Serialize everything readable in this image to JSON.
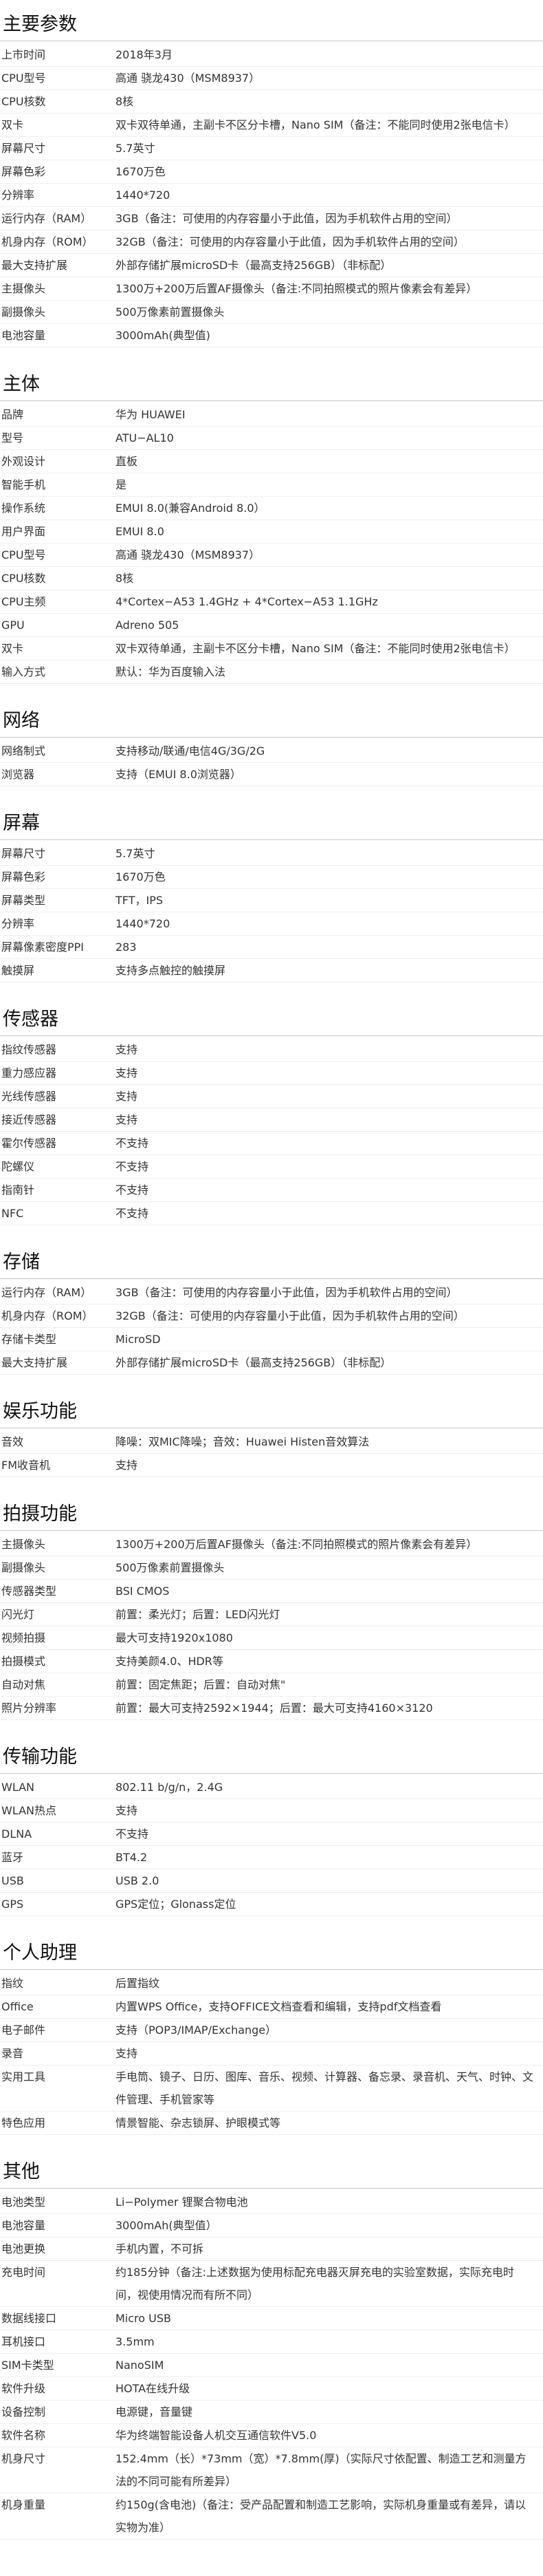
{
  "sections": [
    {
      "title": "主要参数",
      "rows": [
        {
          "label": "上市时间",
          "value": "2018年3月"
        },
        {
          "label": "CPU型号",
          "value": "高通 骁龙430（MSM8937）"
        },
        {
          "label": "CPU核数",
          "value": "8核"
        },
        {
          "label": "双卡",
          "value": "双卡双待单通，主副卡不区分卡槽，Nano SIM（备注：不能同时使用2张电信卡）"
        },
        {
          "label": "屏幕尺寸",
          "value": "5.7英寸"
        },
        {
          "label": "屏幕色彩",
          "value": "1670万色"
        },
        {
          "label": "分辨率",
          "value": "1440*720"
        },
        {
          "label": "运行内存（RAM）",
          "value": "3GB（备注：可使用的内存容量小于此值，因为手机软件占用的空间）"
        },
        {
          "label": "机身内存（ROM）",
          "value": "32GB（备注：可使用的内存容量小于此值，因为手机软件占用的空间）"
        },
        {
          "label": "最大支持扩展",
          "value": "外部存储扩展microSD卡（最高支持256GB）（非标配）"
        },
        {
          "label": "主摄像头",
          "value": "1300万+200万后置AF摄像头（备注:不同拍照模式的照片像素会有差异）"
        },
        {
          "label": "副摄像头",
          "value": "500万像素前置摄像头"
        },
        {
          "label": "电池容量",
          "value": "3000mAh(典型值)"
        }
      ]
    },
    {
      "title": "主体",
      "rows": [
        {
          "label": "品牌",
          "value": "华为 HUAWEI"
        },
        {
          "label": "型号",
          "value": "ATU−AL10"
        },
        {
          "label": "外观设计",
          "value": "直板"
        },
        {
          "label": "智能手机",
          "value": "是"
        },
        {
          "label": "操作系统",
          "value": "EMUI 8.0(兼容Android 8.0）"
        },
        {
          "label": "用户界面",
          "value": "EMUI 8.0"
        },
        {
          "label": "CPU型号",
          "value": "高通 骁龙430（MSM8937）"
        },
        {
          "label": "CPU核数",
          "value": "8核"
        },
        {
          "label": "CPU主频",
          "value": "4*Cortex−A53 1.4GHz + 4*Cortex−A53 1.1GHz"
        },
        {
          "label": "GPU",
          "value": "Adreno 505"
        },
        {
          "label": "双卡",
          "value": "双卡双待单通，主副卡不区分卡槽，Nano SIM（备注：不能同时使用2张电信卡）"
        },
        {
          "label": "输入方式",
          "value": "默认：华为百度输入法"
        }
      ]
    },
    {
      "title": "网络",
      "rows": [
        {
          "label": "网络制式",
          "value": "支持移动/联通/电信4G/3G/2G"
        },
        {
          "label": "浏览器",
          "value": "支持（EMUI 8.0浏览器）"
        }
      ]
    },
    {
      "title": "屏幕",
      "rows": [
        {
          "label": "屏幕尺寸",
          "value": "5.7英寸"
        },
        {
          "label": "屏幕色彩",
          "value": "1670万色"
        },
        {
          "label": "屏幕类型",
          "value": "TFT，IPS"
        },
        {
          "label": "分辨率",
          "value": "1440*720"
        },
        {
          "label": "屏幕像素密度PPI",
          "value": "283"
        },
        {
          "label": "触摸屏",
          "value": "支持多点触控的触摸屏"
        }
      ]
    },
    {
      "title": "传感器",
      "rows": [
        {
          "label": "指纹传感器",
          "value": "支持"
        },
        {
          "label": "重力感应器",
          "value": "支持"
        },
        {
          "label": "光线传感器",
          "value": "支持"
        },
        {
          "label": "接近传感器",
          "value": "支持"
        },
        {
          "label": "霍尔传感器",
          "value": "不支持"
        },
        {
          "label": "陀螺仪",
          "value": "不支持"
        },
        {
          "label": "指南针",
          "value": "不支持"
        },
        {
          "label": "NFC",
          "value": "不支持"
        }
      ]
    },
    {
      "title": "存储",
      "rows": [
        {
          "label": "运行内存（RAM）",
          "value": "3GB（备注：可使用的内存容量小于此值，因为手机软件占用的空间）"
        },
        {
          "label": "机身内存（ROM）",
          "value": "32GB（备注：可使用的内存容量小于此值，因为手机软件占用的空间）"
        },
        {
          "label": "存储卡类型",
          "value": "MicroSD"
        },
        {
          "label": "最大支持扩展",
          "value": "外部存储扩展microSD卡（最高支持256GB）（非标配）"
        }
      ]
    },
    {
      "title": "娱乐功能",
      "rows": [
        {
          "label": "音效",
          "value": "降噪：双MIC降噪；音效：Huawei Histen音效算法"
        },
        {
          "label": "FM收音机",
          "value": "支持"
        }
      ]
    },
    {
      "title": "拍摄功能",
      "rows": [
        {
          "label": "主摄像头",
          "value": "1300万+200万后置AF摄像头（备注:不同拍照模式的照片像素会有差异）"
        },
        {
          "label": "副摄像头",
          "value": "500万像素前置摄像头"
        },
        {
          "label": "传感器类型",
          "value": "BSI CMOS"
        },
        {
          "label": "闪光灯",
          "value": "前置：柔光灯；后置：LED闪光灯"
        },
        {
          "label": "视频拍摄",
          "value": "最大可支持1920x1080"
        },
        {
          "label": "拍摄模式",
          "value": "支持美颜4.0、HDR等"
        },
        {
          "label": "自动对焦",
          "value": "前置：固定焦距；后置：自动对焦\""
        },
        {
          "label": "照片分辨率",
          "value": "前置：最大可支持2592×1944；后置：最大可支持4160×3120"
        }
      ]
    },
    {
      "title": "传输功能",
      "rows": [
        {
          "label": "WLAN",
          "value": "802.11 b/g/n，2.4G"
        },
        {
          "label": "WLAN热点",
          "value": "支持"
        },
        {
          "label": "DLNA",
          "value": "不支持"
        },
        {
          "label": "蓝牙",
          "value": "BT4.2"
        },
        {
          "label": "USB",
          "value": "USB 2.0"
        },
        {
          "label": "GPS",
          "value": "GPS定位；Glonass定位"
        }
      ]
    },
    {
      "title": "个人助理",
      "rows": [
        {
          "label": "指纹",
          "value": "后置指纹"
        },
        {
          "label": "Office",
          "value": "内置WPS Office，支持OFFICE文档查看和编辑，支持pdf文档查看"
        },
        {
          "label": "电子邮件",
          "value": "支持（POP3/IMAP/Exchange）"
        },
        {
          "label": "录音",
          "value": "支持"
        },
        {
          "label": "实用工具",
          "value": "手电筒、镜子、日历、图库、音乐、视频、计算器、备忘录、录音机、天气、时钟、文件管理、手机管家等"
        },
        {
          "label": "特色应用",
          "value": "情景智能、杂志锁屏、护眼模式等"
        }
      ]
    },
    {
      "title": "其他",
      "rows": [
        {
          "label": "电池类型",
          "value": "Li−Polymer 锂聚合物电池"
        },
        {
          "label": "电池容量",
          "value": "3000mAh(典型值）"
        },
        {
          "label": "电池更换",
          "value": "手机内置，不可拆"
        },
        {
          "label": "充电时间",
          "value": "约185分钟（备注:上述数据为使用标配充电器灭屏充电的实验室数据，实际充电时间，视使用情况而有所不同）"
        },
        {
          "label": "数据线接口",
          "value": "Micro USB"
        },
        {
          "label": "耳机接口",
          "value": "3.5mm"
        },
        {
          "label": "SIM卡类型",
          "value": "NanoSIM"
        },
        {
          "label": "软件升级",
          "value": "HOTA在线升级"
        },
        {
          "label": "设备控制",
          "value": "电源键，音量键"
        },
        {
          "label": "软件名称",
          "value": "华为终端智能设备人机交互通信软件V5.0"
        },
        {
          "label": "机身尺寸",
          "value": "152.4mm（长）*73mm（宽）*7.8mm(厚)（实际尺寸依配置、制造工艺和测量方法的不同可能有所差异）"
        },
        {
          "label": "机身重量",
          "value": "约150g(含电池)（备注：受产品配置和制造工艺影响，实际机身重量或有差异，请以实物为准）"
        }
      ]
    }
  ]
}
